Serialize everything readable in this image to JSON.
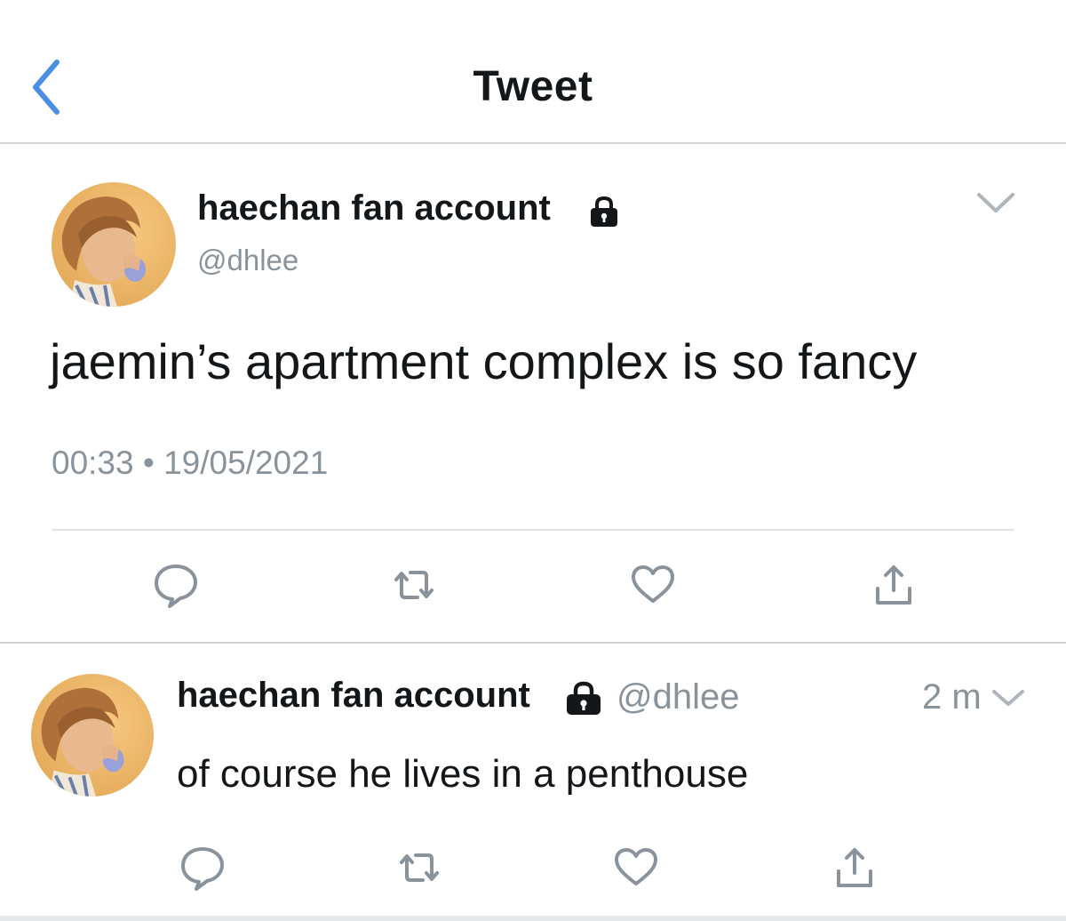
{
  "header": {
    "title": "Tweet",
    "back_icon": "chevron-left-icon"
  },
  "colors": {
    "accent": "#4a90e2",
    "secondary_text": "#8a939b",
    "icon_gray": "#8a939b"
  },
  "main_tweet": {
    "display_name": "haechan fan account",
    "protected": true,
    "handle": "@dhlee",
    "text": "jaemin’s apartment complex is so fancy",
    "timestamp": "00:33 • 19/05/2021",
    "actions": [
      "reply-icon",
      "retweet-icon",
      "like-icon",
      "share-icon"
    ]
  },
  "reply_tweet": {
    "display_name": "haechan fan account",
    "protected": true,
    "handle": "@dhlee",
    "time": "2 m",
    "text": "of course he lives in a penthouse",
    "actions": [
      "reply-icon",
      "retweet-icon",
      "like-icon",
      "share-icon"
    ]
  }
}
